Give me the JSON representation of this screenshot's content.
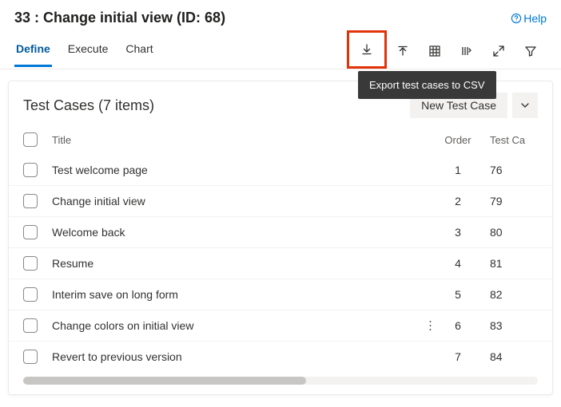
{
  "header": {
    "title": "33 : Change initial view (ID: 68)",
    "help": "Help"
  },
  "tabs": {
    "define": "Define",
    "execute": "Execute",
    "chart": "Chart"
  },
  "tooltip": "Export test cases to CSV",
  "card": {
    "title": "Test Cases (7 items)",
    "newBtn": "New Test Case"
  },
  "cols": {
    "title": "Title",
    "order": "Order",
    "tcid": "Test Ca"
  },
  "rows": [
    {
      "title": "Test welcome page",
      "order": "1",
      "tcid": "76"
    },
    {
      "title": "Change initial view",
      "order": "2",
      "tcid": "79"
    },
    {
      "title": "Welcome back",
      "order": "3",
      "tcid": "80"
    },
    {
      "title": "Resume",
      "order": "4",
      "tcid": "81"
    },
    {
      "title": "Interim save on long form",
      "order": "5",
      "tcid": "82"
    },
    {
      "title": "Change colors on initial view",
      "order": "6",
      "tcid": "83"
    },
    {
      "title": "Revert to previous version",
      "order": "7",
      "tcid": "84"
    }
  ]
}
